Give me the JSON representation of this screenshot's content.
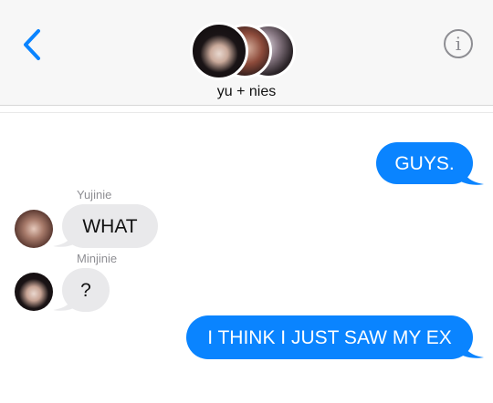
{
  "header": {
    "back_icon": "chevron-left-icon",
    "info_icon": "info-icon",
    "info_glyph": "i",
    "group_name": "yu + nies",
    "accent_color": "#0a84ff"
  },
  "messages": [
    {
      "direction": "sent",
      "text": "GUYS."
    },
    {
      "direction": "received",
      "sender": "Yujinie",
      "text": "WHAT"
    },
    {
      "direction": "received",
      "sender": "Minjinie",
      "text": "?"
    },
    {
      "direction": "sent",
      "text": "I THINK I JUST SAW MY EX"
    }
  ]
}
